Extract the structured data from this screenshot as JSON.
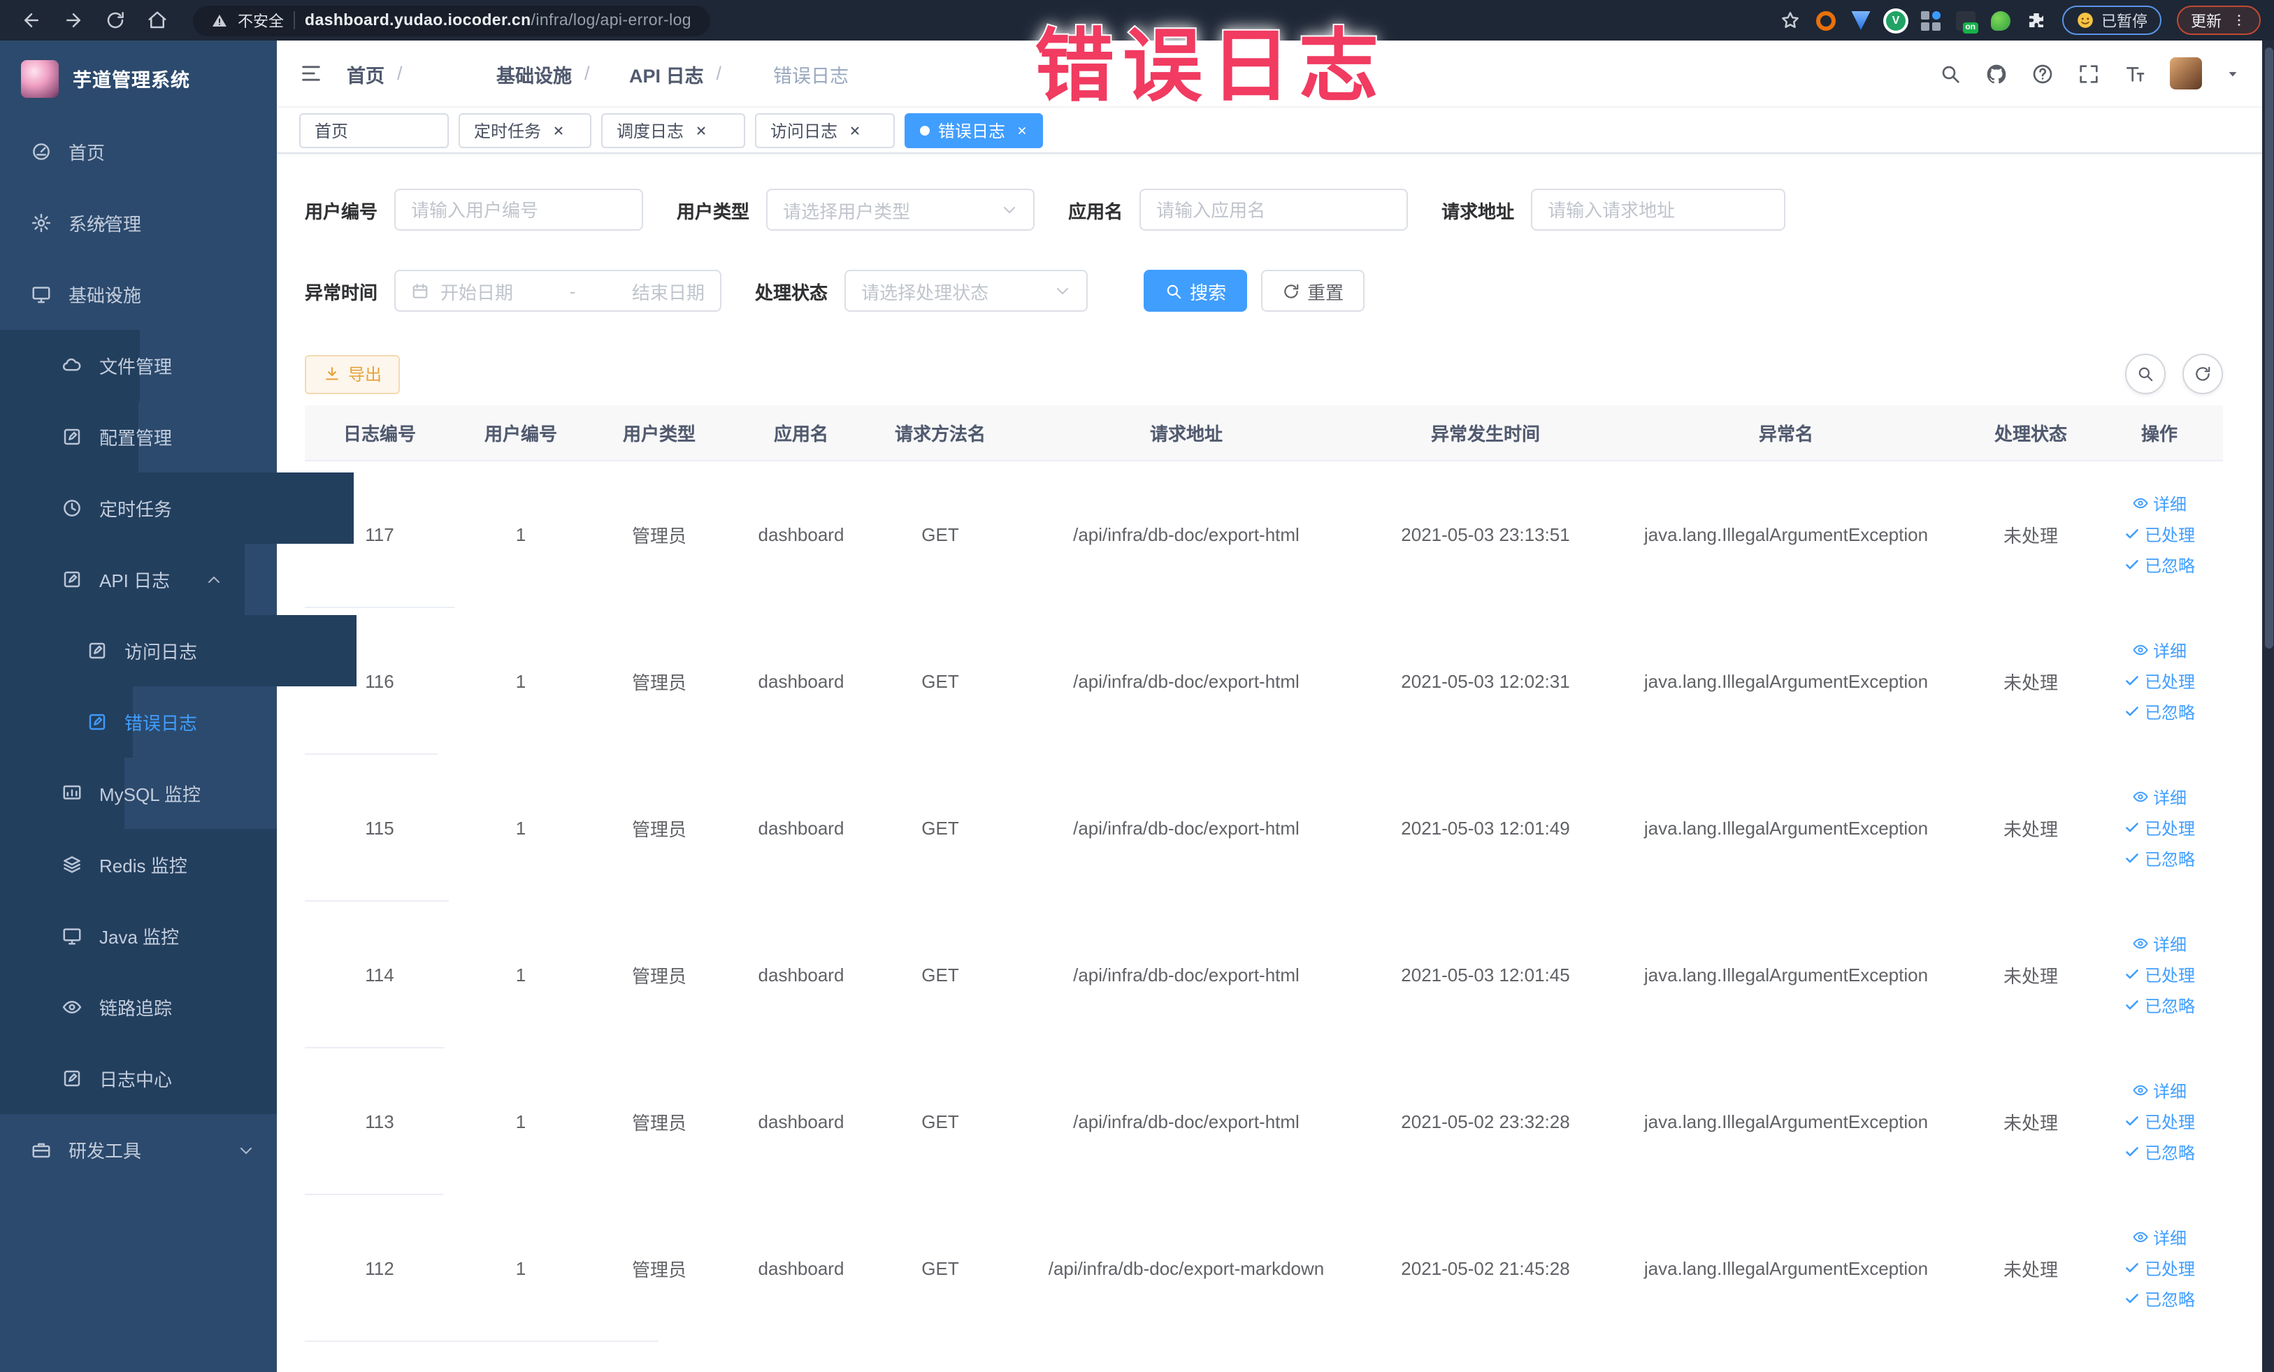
{
  "colors": {
    "accent": "#409eff",
    "warning": "#e6a23c",
    "warning-bg": "#fdf6ec",
    "warning-border": "#f5dab1",
    "overlay-pink": "#f13b61",
    "sidebar-bg": "#2c4a6d",
    "sidebar-sub-bg": "#233f5e",
    "chrome-bg": "#1e2736"
  },
  "browser": {
    "security_label": "不安全",
    "url_domain": "dashboard.yudao.iocoder.cn",
    "url_path": "/infra/log/api-error-log",
    "ext_badge": "on",
    "ext_v_label": "V",
    "paused_label": "已暂停",
    "update_label": "更新"
  },
  "overlay": {
    "text": "错误日志"
  },
  "sidebar": {
    "logo_title": "芋道管理系统",
    "items": [
      {
        "label": "首页",
        "icon": "dashboard"
      },
      {
        "label": "系统管理",
        "icon": "gear",
        "chev": "chevron-down"
      },
      {
        "label": "基础设施",
        "icon": "monitor",
        "chev": "chevron-up"
      },
      {
        "label": "文件管理",
        "icon": "cloud",
        "sub": true
      },
      {
        "label": "配置管理",
        "icon": "edit",
        "sub": true
      },
      {
        "label": "定时任务",
        "icon": "clock",
        "sub": true
      },
      {
        "label": "API 日志",
        "icon": "edit",
        "sub": true,
        "chev": "chevron-up"
      },
      {
        "label": "访问日志",
        "icon": "edit",
        "sub": true,
        "l3": true
      },
      {
        "label": "错误日志",
        "icon": "edit",
        "sub": true,
        "l3": true,
        "active": true
      },
      {
        "label": "MySQL 监控",
        "icon": "chart",
        "sub": true
      },
      {
        "label": "Redis 监控",
        "icon": "layers",
        "sub": true
      },
      {
        "label": "Java 监控",
        "icon": "monitor",
        "sub": true
      },
      {
        "label": "链路追踪",
        "icon": "eye",
        "sub": true
      },
      {
        "label": "日志中心",
        "icon": "edit",
        "sub": true
      },
      {
        "label": "研发工具",
        "icon": "briefcase",
        "chev": "chevron-down"
      }
    ]
  },
  "header": {
    "breadcrumb": [
      {
        "label": "首页"
      },
      {
        "label": "基础设施"
      },
      {
        "label": "API 日志"
      },
      {
        "label": "错误日志",
        "current": true
      }
    ],
    "breadcrumb_separator": "/",
    "tabs": [
      {
        "label": "首页"
      },
      {
        "label": "定时任务",
        "closable": true
      },
      {
        "label": "调度日志",
        "closable": true
      },
      {
        "label": "访问日志",
        "closable": true
      },
      {
        "label": "错误日志",
        "closable": true,
        "active": true
      }
    ]
  },
  "filters": {
    "user_id": {
      "label": "用户编号",
      "placeholder": "请输入用户编号"
    },
    "user_type": {
      "label": "用户类型",
      "placeholder": "请选择用户类型"
    },
    "app_name": {
      "label": "应用名",
      "placeholder": "请输入应用名"
    },
    "request_url": {
      "label": "请求地址",
      "placeholder": "请输入请求地址"
    },
    "exception_time": {
      "label": "异常时间",
      "start_placeholder": "开始日期",
      "separator": "-",
      "end_placeholder": "结束日期"
    },
    "process_status": {
      "label": "处理状态",
      "placeholder": "请选择处理状态"
    },
    "search_label": "搜索",
    "reset_label": "重置"
  },
  "toolbar": {
    "export_label": "导出"
  },
  "table": {
    "columns": [
      "日志编号",
      "用户编号",
      "用户类型",
      "应用名",
      "请求方法名",
      "请求地址",
      "异常发生时间",
      "异常名",
      "处理状态",
      "操作"
    ],
    "actions": {
      "detail": "详细",
      "processed": "已处理",
      "ignored": "已忽略"
    },
    "rows": [
      {
        "id": "117",
        "user_id": "1",
        "user_type": "管理员",
        "app": "dashboard",
        "method": "GET",
        "url": "/api/infra/db-doc/export-html",
        "time": "2021-05-03 23:13:51",
        "exception": "java.lang.IllegalArgumentException",
        "status": "未处理"
      },
      {
        "id": "116",
        "user_id": "1",
        "user_type": "管理员",
        "app": "dashboard",
        "method": "GET",
        "url": "/api/infra/db-doc/export-html",
        "time": "2021-05-03 12:02:31",
        "exception": "java.lang.IllegalArgumentException",
        "status": "未处理"
      },
      {
        "id": "115",
        "user_id": "1",
        "user_type": "管理员",
        "app": "dashboard",
        "method": "GET",
        "url": "/api/infra/db-doc/export-html",
        "time": "2021-05-03 12:01:49",
        "exception": "java.lang.IllegalArgumentException",
        "status": "未处理"
      },
      {
        "id": "114",
        "user_id": "1",
        "user_type": "管理员",
        "app": "dashboard",
        "method": "GET",
        "url": "/api/infra/db-doc/export-html",
        "time": "2021-05-03 12:01:45",
        "exception": "java.lang.IllegalArgumentException",
        "status": "未处理"
      },
      {
        "id": "113",
        "user_id": "1",
        "user_type": "管理员",
        "app": "dashboard",
        "method": "GET",
        "url": "/api/infra/db-doc/export-html",
        "time": "2021-05-02 23:32:28",
        "exception": "java.lang.IllegalArgumentException",
        "status": "未处理"
      },
      {
        "id": "112",
        "user_id": "1",
        "user_type": "管理员",
        "app": "dashboard",
        "method": "GET",
        "url": "/api/infra/db-doc/export-markdown",
        "time": "2021-05-02 21:45:28",
        "exception": "java.lang.IllegalArgumentException",
        "status": "未处理"
      }
    ]
  }
}
